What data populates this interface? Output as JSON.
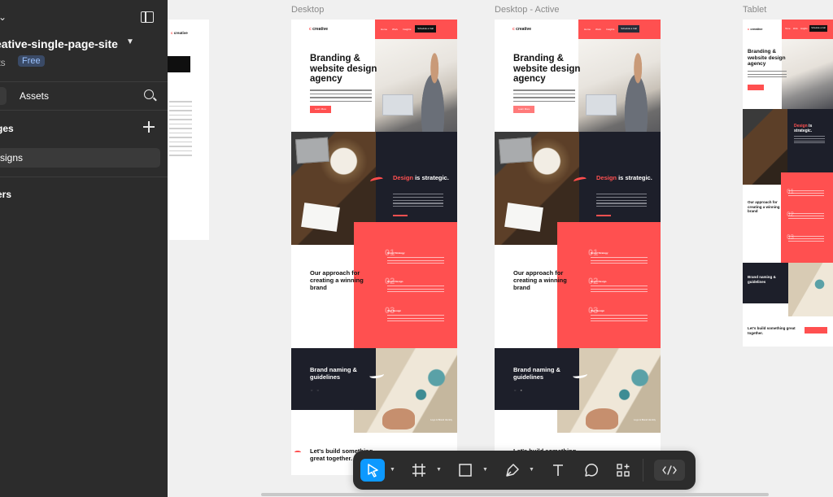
{
  "sidebar": {
    "file_name": "eative-single-page-site",
    "drafts_label": "fts",
    "plan_badge": "Free",
    "assets_tab": "Assets",
    "pages_label": "ges",
    "current_page": "signs",
    "layers_label": "ers"
  },
  "canvas": {
    "frame_labels": [
      "Desktop",
      "Desktop - Active",
      "Tablet"
    ]
  },
  "site": {
    "logo_text": "creative",
    "nav_items": [
      "Home",
      "Work",
      "Insights"
    ],
    "header_button": "Schedule a Call",
    "hero_title": "Branding & website design agency",
    "hero_button": "Learn More",
    "design_title_accent": "Design",
    "design_title_rest": " is strategic.",
    "approach_title": "Our approach for creating a winning brand",
    "steps": [
      {
        "num": "01",
        "title": "Brand Strategy"
      },
      {
        "num": "02",
        "title": "Brand Design"
      },
      {
        "num": "03",
        "title": "Web Design"
      }
    ],
    "brand_title": "Brand naming & guidelines",
    "brand_caption": "Logo & Brand Identity",
    "cta_title": "Let's build something great together."
  },
  "toolbar": {
    "tools": [
      "move-tool",
      "frame-tool",
      "shape-tool",
      "pen-tool",
      "text-tool",
      "comment-tool",
      "actions-tool"
    ],
    "active_tool": "move-tool",
    "dev_mode": "dev-mode-toggle"
  },
  "colors": {
    "accent": "#ff5050",
    "dark_section": "#1d1f2a",
    "toolbar_bg": "#2c2c2c",
    "active_tool": "#0d99ff",
    "badge_bg": "#3a4a66",
    "badge_text": "#9cc3ff"
  }
}
